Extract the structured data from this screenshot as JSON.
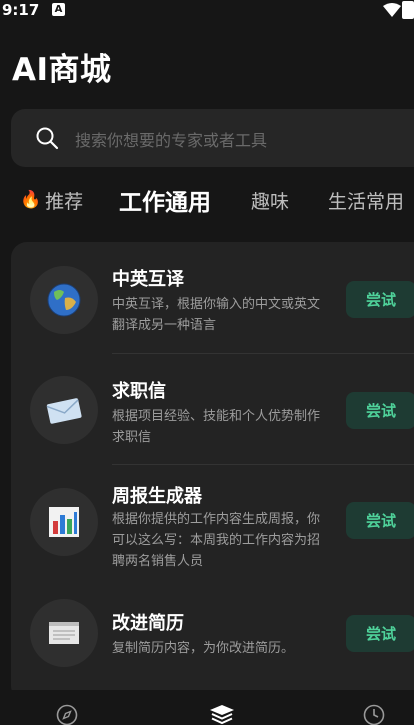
{
  "status_bar": {
    "time": "9:17",
    "notification_letter": "A"
  },
  "page": {
    "title": "AI商城"
  },
  "search": {
    "placeholder": "搜索你想要的专家或者工具"
  },
  "tabs": [
    {
      "label": "推荐",
      "icon": "fire-icon"
    },
    {
      "label": "工作通用",
      "active": true
    },
    {
      "label": "趣味"
    },
    {
      "label": "生活常用"
    }
  ],
  "items": [
    {
      "title": "中英互译",
      "desc": "中英互译，根据你输入的中文或英文翻译成另一种语言",
      "button": "尝试",
      "icon": "globe-icon"
    },
    {
      "title": "求职信",
      "desc": "根据项目经验、技能和个人优势制作求职信",
      "button": "尝试",
      "icon": "envelope-icon"
    },
    {
      "title": "周报生成器",
      "desc": "根据你提供的工作内容生成周报，你可以这么写：本周我的工作内容为招聘两名销售人员",
      "button": "尝试",
      "icon": "bar-chart-icon"
    },
    {
      "title": "改进简历",
      "desc": "复制简历内容，为你改进简历。",
      "button": "尝试",
      "icon": "document-icon"
    }
  ],
  "colors": {
    "background": "#161616",
    "card": "#232323",
    "accent": "#4fd39b",
    "button_bg": "#1e3b33"
  },
  "bottom_nav": [
    {
      "icon": "compass-icon"
    },
    {
      "icon": "layers-icon",
      "active": true
    },
    {
      "icon": "clock-icon"
    }
  ]
}
